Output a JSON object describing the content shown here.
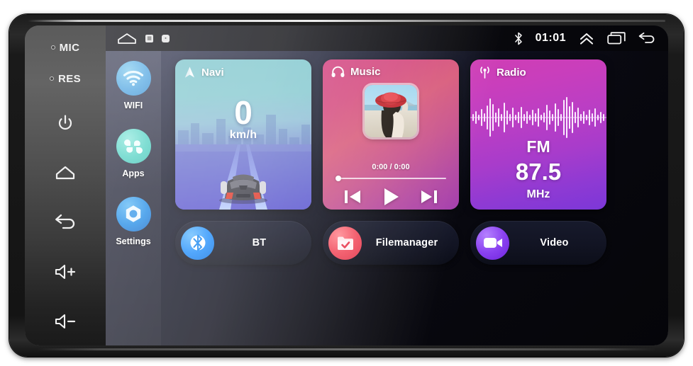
{
  "device": {
    "hardware_buttons": [
      {
        "name": "mic",
        "label": "MIC",
        "icon": "mic-pinhole-icon",
        "has_dot": true
      },
      {
        "name": "reset",
        "label": "RES",
        "icon": "reset-pinhole-icon",
        "has_dot": true
      },
      {
        "name": "power",
        "label": "",
        "icon": "power-icon",
        "has_dot": false
      },
      {
        "name": "home",
        "label": "",
        "icon": "home-icon",
        "has_dot": false
      },
      {
        "name": "back",
        "label": "",
        "icon": "back-arrow-icon",
        "has_dot": false
      },
      {
        "name": "volume-up",
        "label": "",
        "icon": "volume-up-icon",
        "has_dot": false
      },
      {
        "name": "volume-down",
        "label": "",
        "icon": "volume-down-icon",
        "has_dot": false
      }
    ]
  },
  "status_bar": {
    "home_icon": "home-icon",
    "mini_icon_1": "sim-card-icon",
    "mini_icon_2": "sd-card-icon",
    "bluetooth_icon": "bluetooth-icon",
    "clock": "01:01",
    "expand_icon": "double-chevron-up-icon",
    "recents_icon": "recents-icon",
    "back_icon": "back-arrow-icon"
  },
  "dock": {
    "items": [
      {
        "label": "WIFI",
        "icon": "wifi-icon",
        "color": "#4aa8e0"
      },
      {
        "label": "Apps",
        "icon": "apps-icon",
        "color": "#4fd2c6"
      },
      {
        "label": "Settings",
        "icon": "settings-icon",
        "color": "#1e8fe8"
      }
    ]
  },
  "cards": {
    "navi": {
      "title": "Navi",
      "icon": "navigation-arrow-icon",
      "speed": "0",
      "speed_unit": "km/h",
      "accent": "#7fc6cd"
    },
    "music": {
      "title": "Music",
      "icon": "headphones-icon",
      "album_art": "woman-red-hat-beach-photo",
      "time": "0:00 / 0:00",
      "progress_percent": 0,
      "controls": [
        {
          "name": "previous-track-button",
          "icon": "skip-previous-icon"
        },
        {
          "name": "play-button",
          "icon": "play-icon"
        },
        {
          "name": "next-track-button",
          "icon": "skip-next-icon"
        }
      ],
      "accent": "#d1407f"
    },
    "radio": {
      "title": "Radio",
      "icon": "radio-broadcast-icon",
      "band": "FM",
      "frequency": "87.5",
      "unit": "MHz",
      "accent": "#bb3ec4"
    }
  },
  "pills": [
    {
      "label": "BT",
      "icon": "bluetooth-icon",
      "color": "#1f8fff"
    },
    {
      "label": "Filemanager",
      "icon": "folder-check-icon",
      "color": "#f04a5e"
    },
    {
      "label": "Video",
      "icon": "video-camera-icon",
      "color": "#8b41f0"
    }
  ]
}
